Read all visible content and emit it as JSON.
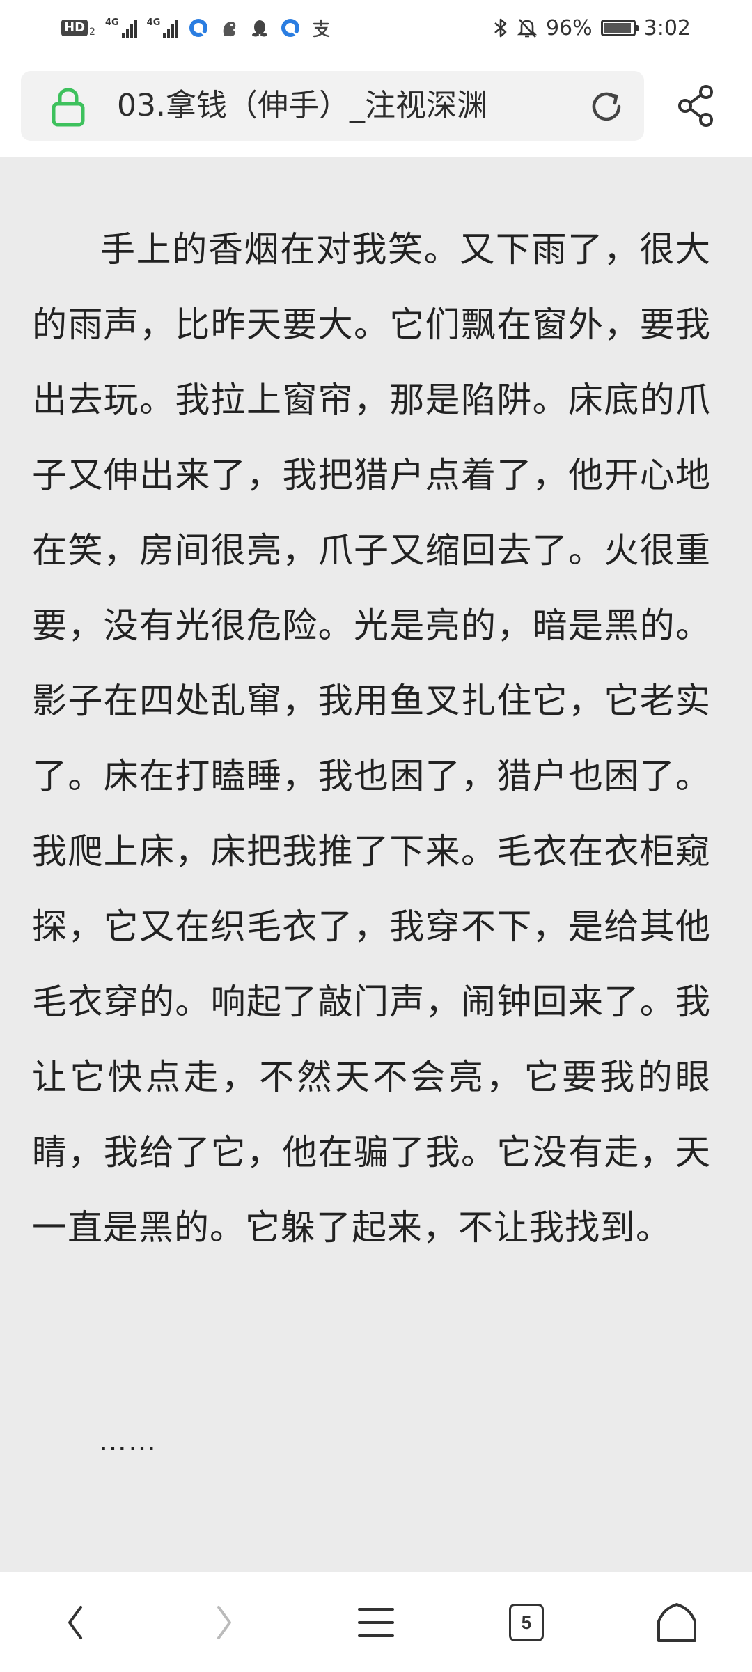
{
  "status_bar": {
    "hd_label": "HD",
    "hd_sub": "2",
    "network_1": "4G",
    "network_2": "4G",
    "battery_percent_text": "96%",
    "battery_level": 0.96,
    "time": "3:02"
  },
  "address_bar": {
    "title": "03.拿钱（伸手）_注视深渊",
    "lock_color": "#3ec15d"
  },
  "content": {
    "paragraph": "手上的香烟在对我笑。又下雨了，很大的雨声，比昨天要大。它们飘在窗外，要我出去玩。我拉上窗帘，那是陷阱。床底的爪子又伸出来了，我把猎户点着了，他开心地在笑，房间很亮，爪子又缩回去了。火很重要，没有光很危险。光是亮的，暗是黑的。影子在四处乱窜，我用鱼叉扎住它，它老实了。床在打瞌睡，我也困了，猎户也困了。我爬上床，床把我推了下来。毛衣在衣柜窥探，它又在织毛衣了，我穿不下，是给其他毛衣穿的。响起了敲门声，闹钟回来了。我让它快点走，不然天不会亮，它要我的眼睛，我给了它，他在骗了我。它没有走，天一直是黑的。它躲了起来，不让我找到。",
    "ellipsis": "……"
  },
  "bottom_nav": {
    "tab_count": "5"
  },
  "icons": {
    "lock": "lock-icon",
    "reload": "reload-icon",
    "share": "share-icon",
    "back": "back-icon",
    "forward": "forward-icon",
    "menu": "menu-icon",
    "tabs": "tabs-icon",
    "home": "home-icon",
    "bluetooth": "bluetooth-icon",
    "mute": "bell-off-icon",
    "battery": "battery-icon"
  }
}
